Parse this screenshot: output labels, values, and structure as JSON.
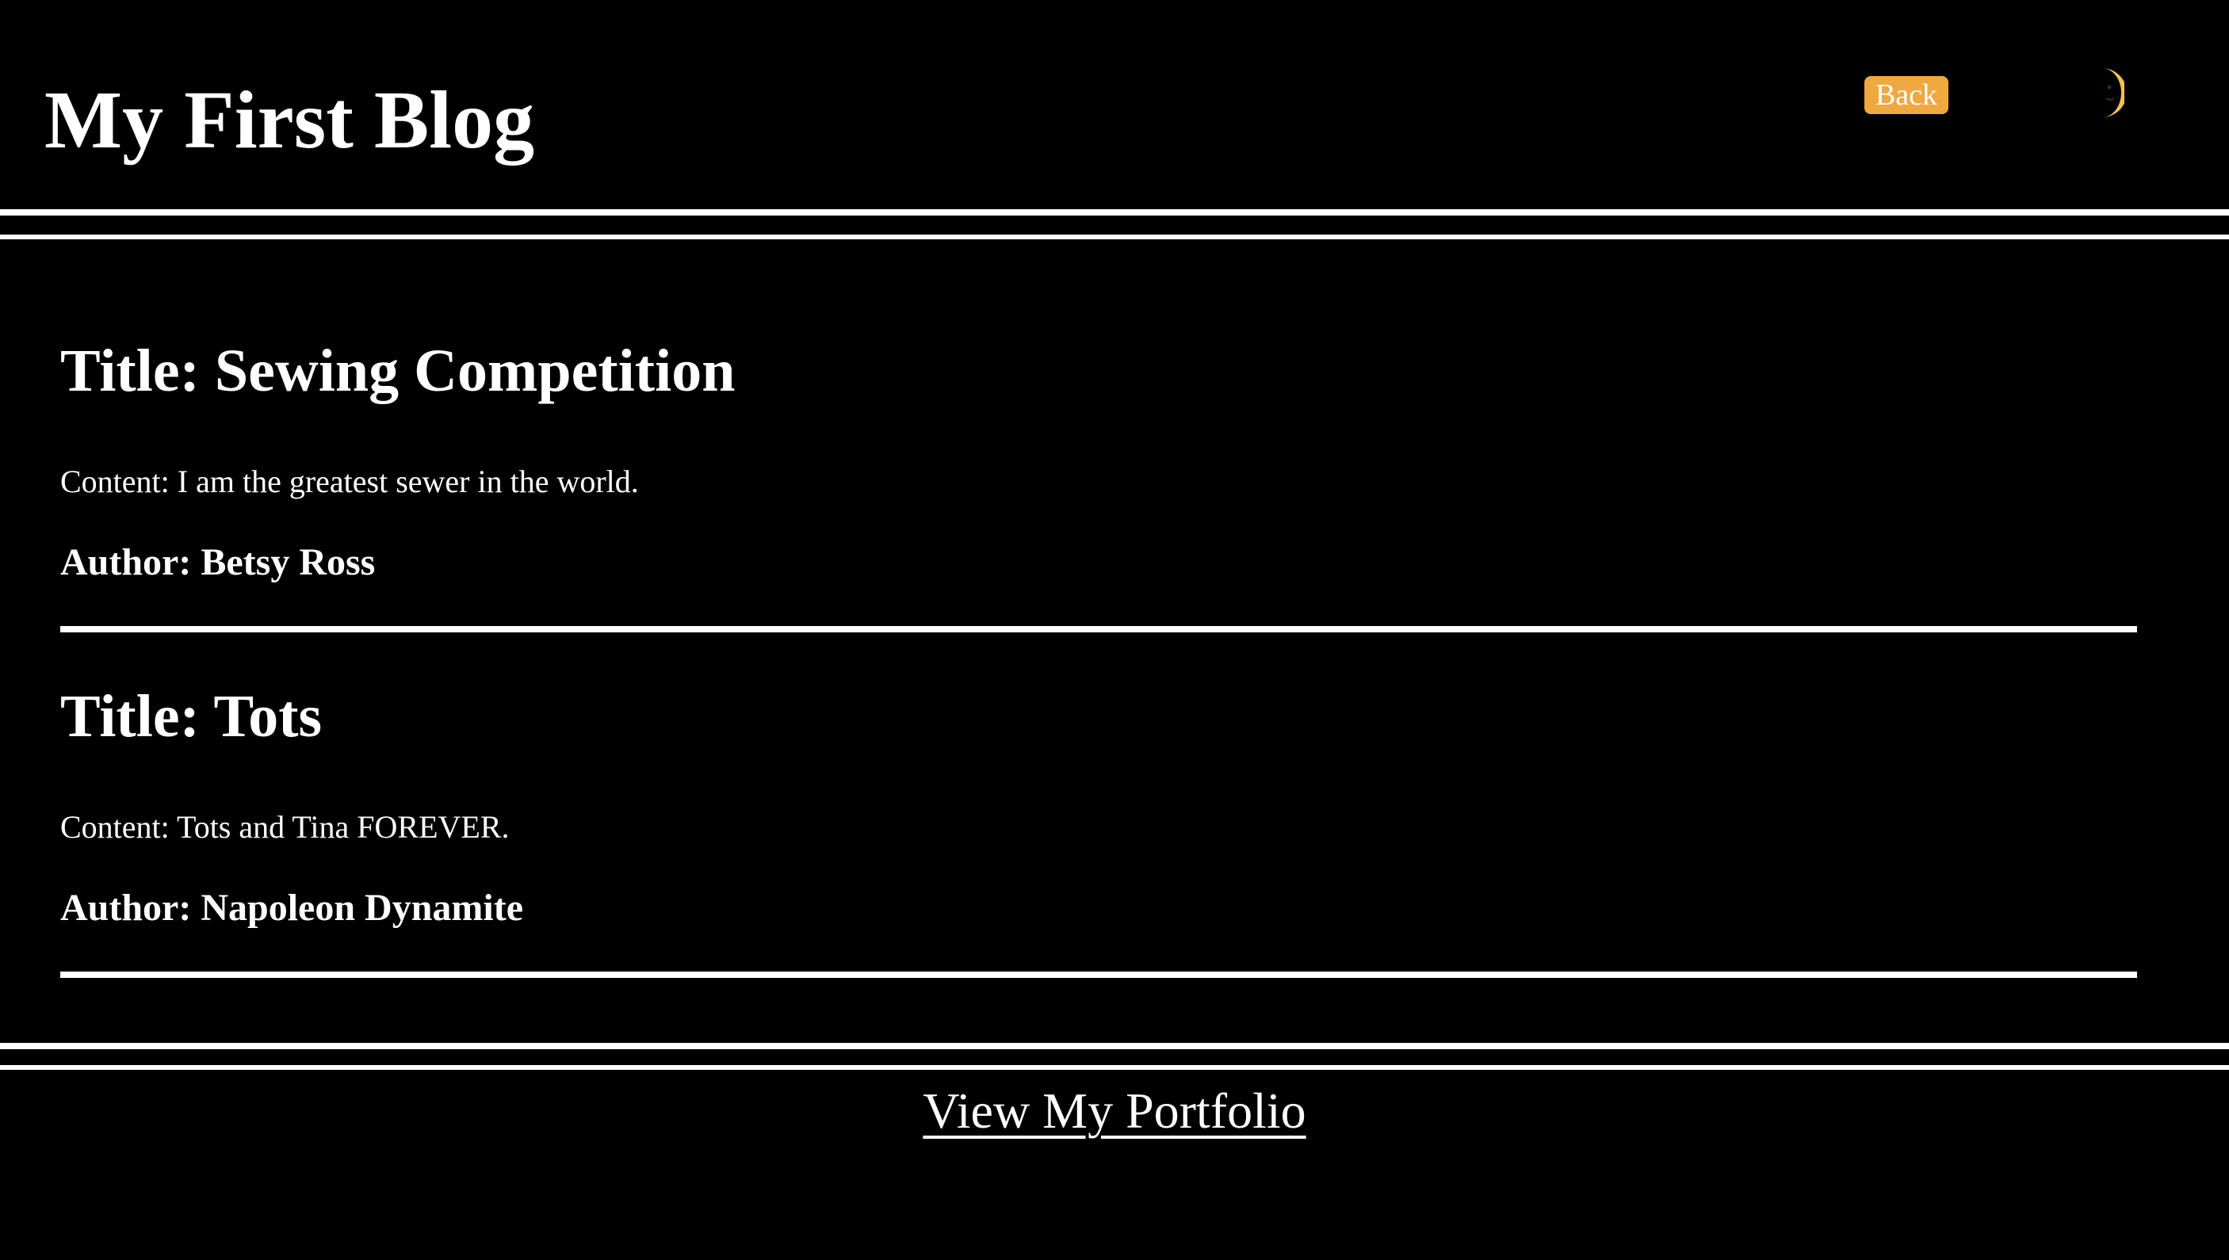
{
  "header": {
    "title": "My First Blog",
    "back_label": "Back",
    "theme_icon": "moon-icon"
  },
  "posts": [
    {
      "title": "Title: Sewing Competition",
      "content": "Content: I am the greatest sewer in the world.",
      "author": "Author: Betsy Ross"
    },
    {
      "title": "Title: Tots",
      "content": "Content: Tots and Tina FOREVER.",
      "author": "Author: Napoleon Dynamite"
    }
  ],
  "footer": {
    "portfolio_label": "View My Portfolio"
  },
  "colors": {
    "background": "#000000",
    "text": "#ffffff",
    "back_button": "#f0a840",
    "moon": "#f2c14e"
  }
}
